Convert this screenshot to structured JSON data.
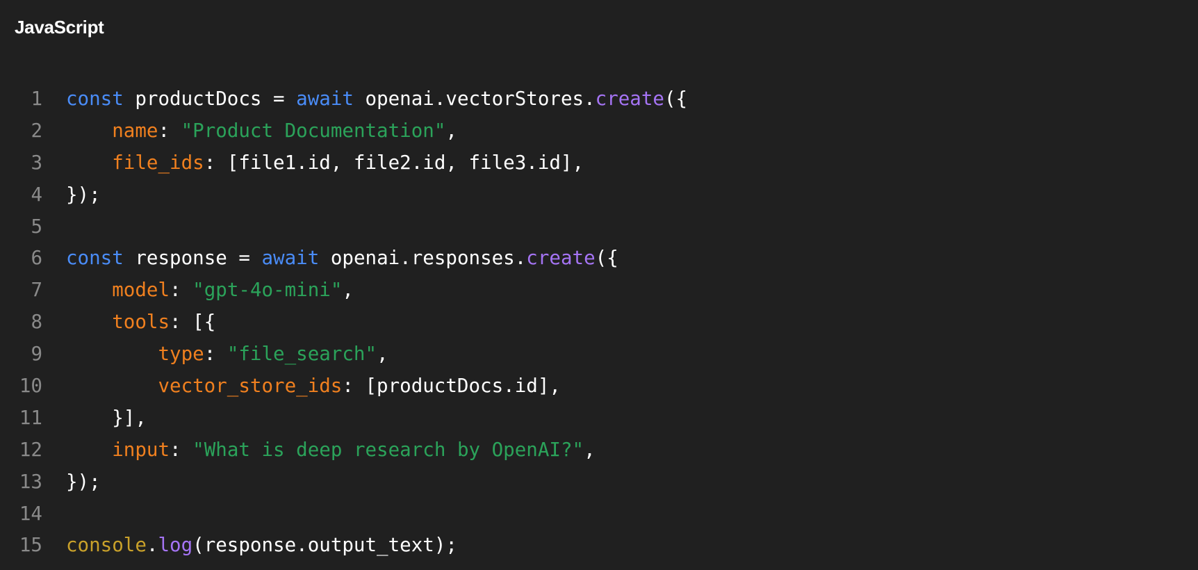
{
  "header": {
    "language": "JavaScript"
  },
  "colors": {
    "background": "#202020",
    "keyword": "#4a8cf7",
    "function": "#a574f4",
    "property_key": "#f0801f",
    "string": "#2ba35a",
    "global_object": "#c9a12a",
    "plain_text": "#ffffff",
    "line_number": "#8a8a8a"
  },
  "code": {
    "lines": [
      {
        "number": "1",
        "tokens": [
          {
            "t": "const",
            "c": "kw"
          },
          {
            "t": " productDocs = ",
            "c": "plain"
          },
          {
            "t": "await",
            "c": "kw"
          },
          {
            "t": " openai.vectorStores.",
            "c": "plain"
          },
          {
            "t": "create",
            "c": "fn"
          },
          {
            "t": "({",
            "c": "plain"
          }
        ]
      },
      {
        "number": "2",
        "tokens": [
          {
            "t": "    ",
            "c": "plain"
          },
          {
            "t": "name",
            "c": "key"
          },
          {
            "t": ": ",
            "c": "plain"
          },
          {
            "t": "\"Product Documentation\"",
            "c": "str"
          },
          {
            "t": ",",
            "c": "plain"
          }
        ]
      },
      {
        "number": "3",
        "tokens": [
          {
            "t": "    ",
            "c": "plain"
          },
          {
            "t": "file_ids",
            "c": "key"
          },
          {
            "t": ": [file1.id, file2.id, file3.id],",
            "c": "plain"
          }
        ]
      },
      {
        "number": "4",
        "tokens": [
          {
            "t": "});",
            "c": "plain"
          }
        ]
      },
      {
        "number": "5",
        "tokens": []
      },
      {
        "number": "6",
        "tokens": [
          {
            "t": "const",
            "c": "kw"
          },
          {
            "t": " response = ",
            "c": "plain"
          },
          {
            "t": "await",
            "c": "kw"
          },
          {
            "t": " openai.responses.",
            "c": "plain"
          },
          {
            "t": "create",
            "c": "fn"
          },
          {
            "t": "({",
            "c": "plain"
          }
        ]
      },
      {
        "number": "7",
        "tokens": [
          {
            "t": "    ",
            "c": "plain"
          },
          {
            "t": "model",
            "c": "key"
          },
          {
            "t": ": ",
            "c": "plain"
          },
          {
            "t": "\"gpt-4o-mini\"",
            "c": "str"
          },
          {
            "t": ",",
            "c": "plain"
          }
        ]
      },
      {
        "number": "8",
        "tokens": [
          {
            "t": "    ",
            "c": "plain"
          },
          {
            "t": "tools",
            "c": "key"
          },
          {
            "t": ": [{",
            "c": "plain"
          }
        ]
      },
      {
        "number": "9",
        "tokens": [
          {
            "t": "        ",
            "c": "plain"
          },
          {
            "t": "type",
            "c": "key"
          },
          {
            "t": ": ",
            "c": "plain"
          },
          {
            "t": "\"file_search\"",
            "c": "str"
          },
          {
            "t": ",",
            "c": "plain"
          }
        ]
      },
      {
        "number": "10",
        "tokens": [
          {
            "t": "        ",
            "c": "plain"
          },
          {
            "t": "vector_store_ids",
            "c": "key"
          },
          {
            "t": ": [productDocs.id],",
            "c": "plain"
          }
        ]
      },
      {
        "number": "11",
        "tokens": [
          {
            "t": "    }],",
            "c": "plain"
          }
        ]
      },
      {
        "number": "12",
        "tokens": [
          {
            "t": "    ",
            "c": "plain"
          },
          {
            "t": "input",
            "c": "key"
          },
          {
            "t": ": ",
            "c": "plain"
          },
          {
            "t": "\"What is deep research by OpenAI?\"",
            "c": "str"
          },
          {
            "t": ",",
            "c": "plain"
          }
        ]
      },
      {
        "number": "13",
        "tokens": [
          {
            "t": "});",
            "c": "plain"
          }
        ]
      },
      {
        "number": "14",
        "tokens": []
      },
      {
        "number": "15",
        "tokens": [
          {
            "t": "console",
            "c": "obj"
          },
          {
            "t": ".",
            "c": "plain"
          },
          {
            "t": "log",
            "c": "fn"
          },
          {
            "t": "(response.output_text);",
            "c": "plain"
          }
        ]
      }
    ]
  }
}
